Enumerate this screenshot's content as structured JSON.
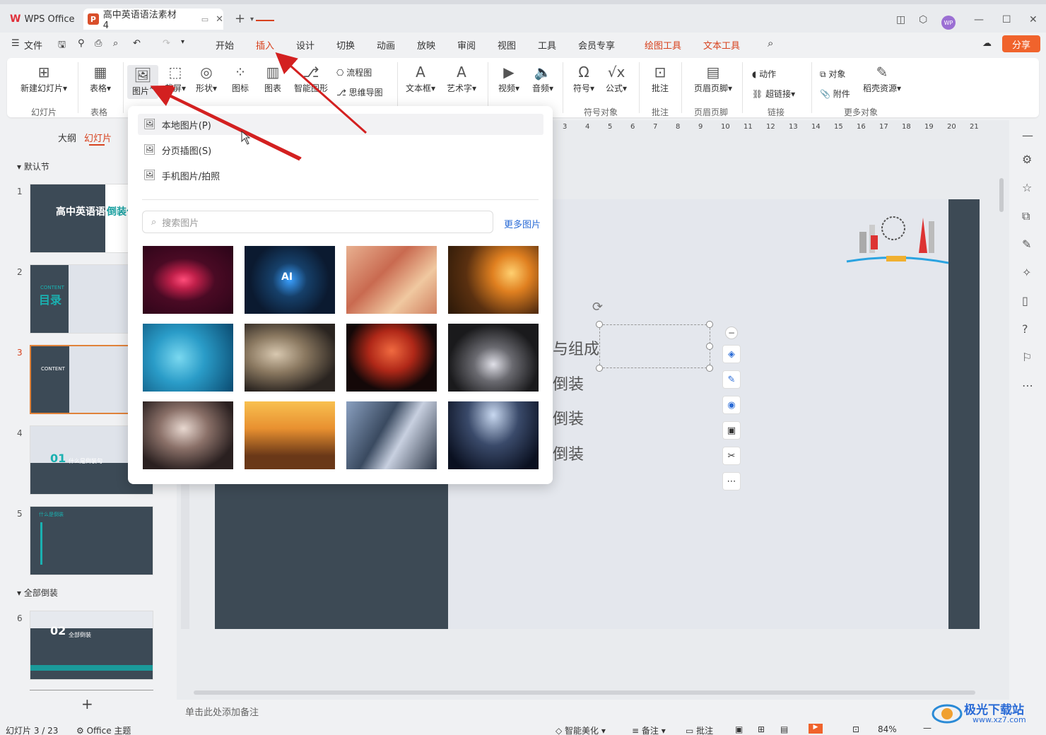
{
  "titlebar": {
    "app_tab": "WPS Office",
    "doc_tab": "高中英语语法素材4",
    "avatar": "WP"
  },
  "menubar": {
    "file": "文件",
    "tabs": [
      "开始",
      "插入",
      "设计",
      "切换",
      "动画",
      "放映",
      "审阅",
      "视图",
      "工具",
      "会员专享"
    ],
    "context_tabs": [
      "绘图工具",
      "文本工具"
    ],
    "share": "分享"
  },
  "ribbon": {
    "new_slide": "新建幻灯片",
    "table": "表格",
    "picture": "图片",
    "screenshot": "截屏",
    "shape": "形状",
    "icon": "图标",
    "chart": "图表",
    "smartart": "智能图形",
    "flowchart": "流程图",
    "mindmap": "思维导图",
    "textbox": "文本框",
    "wordart": "艺术字",
    "video": "视频",
    "audio": "音频",
    "symbol": "符号",
    "formula": "公式",
    "comment": "批注",
    "header_footer": "页眉页脚",
    "action": "动作",
    "hyperlink": "超链接",
    "object": "对象",
    "attachment": "附件",
    "resources": "稻壳资源",
    "groups": {
      "slide": "幻灯片",
      "table": "表格",
      "symbol_obj": "符号对象",
      "comment": "批注",
      "header_footer": "页眉页脚",
      "link": "链接",
      "more": "更多对象"
    }
  },
  "leftpanel": {
    "tab_outline": "大纲",
    "tab_slides": "幻灯片",
    "section1": "默认节",
    "section2": "全部倒装",
    "thumbs": [
      {
        "num": "1",
        "title": "高中英语语法",
        "sub": "倒装句"
      },
      {
        "num": "2",
        "title": "目录",
        "sub": "CONTENT"
      },
      {
        "num": "3",
        "title": "",
        "sub": "CONTENT"
      },
      {
        "num": "4",
        "title": "什么是倒装句",
        "sub": "01"
      },
      {
        "num": "5",
        "title": "什么是倒装",
        "sub": ""
      },
      {
        "num": "6",
        "title": "全部倒装",
        "sub": "02"
      }
    ],
    "add": "+"
  },
  "slide": {
    "line1": "与组成",
    "line2": "倒装",
    "line3": "倒装",
    "line4": "倒装"
  },
  "ruler_labels": [
    "3",
    "4",
    "5",
    "6",
    "7",
    "8",
    "9",
    "10",
    "11",
    "12",
    "13",
    "14",
    "15",
    "16",
    "17",
    "18",
    "19",
    "20",
    "21"
  ],
  "dropdown": {
    "local": "本地图片(P)",
    "paged": "分页插图(S)",
    "phone": "手机图片/拍照",
    "search_placeholder": "搜索图片",
    "more": "更多图片",
    "image_names": [
      "red-light",
      "ai-chip",
      "dna",
      "sparks",
      "bacteria",
      "cat",
      "flamingo",
      "thinking-man",
      "woman-dumbbell",
      "surfer-sunset",
      "building",
      "high-jump"
    ]
  },
  "notes": "单击此处添加备注",
  "status": {
    "slide_count": "幻灯片 3 / 23",
    "theme": "Office 主题",
    "beautify": "智能美化",
    "notes": "备注",
    "comment": "批注",
    "zoom": "84%"
  },
  "watermark": {
    "name": "极光下载站",
    "url": "www.xz7.com"
  },
  "colors": {
    "accent": "#d7421e",
    "share": "#f0632c",
    "slide_dark": "#3d4a55",
    "link": "#2a6bd6"
  }
}
